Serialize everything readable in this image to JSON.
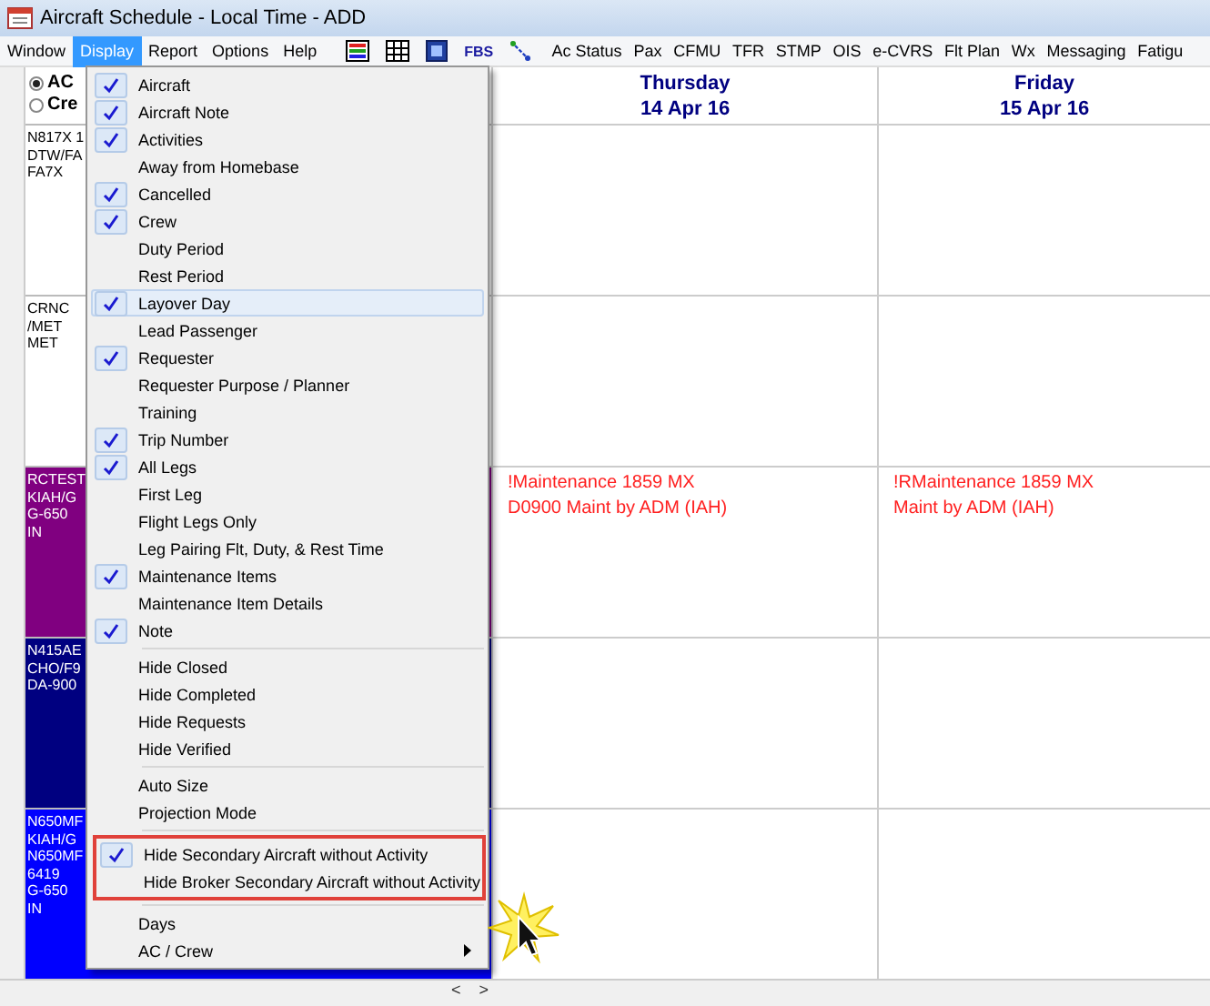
{
  "window": {
    "title": "Aircraft Schedule - Local Time - ADD"
  },
  "menu_bar": {
    "items": [
      {
        "label": "Window",
        "selected": false
      },
      {
        "label": "Display",
        "selected": true
      },
      {
        "label": "Report",
        "selected": false
      },
      {
        "label": "Options",
        "selected": false
      },
      {
        "label": "Help",
        "selected": false
      }
    ],
    "toolbar_text_icon": "FBS",
    "links": [
      "Ac Status",
      "Pax",
      "CFMU",
      "TFR",
      "STMP",
      "OIS",
      "e-CVRS",
      "Flt Plan",
      "Wx",
      "Messaging",
      "Fatigu"
    ]
  },
  "view_mode": [
    {
      "label": "AC",
      "selected": true
    },
    {
      "label": "Cre",
      "selected": false
    }
  ],
  "day_columns": [
    {
      "day": "Thursday",
      "date": "14 Apr 16"
    },
    {
      "day": "Friday",
      "date": "15 Apr 16"
    }
  ],
  "rows": [
    {
      "label": [
        "N817X 1",
        "DTW/FA",
        "FA7X"
      ],
      "color": "#ffffff"
    },
    {
      "label": [
        "CRNC",
        "/MET",
        "MET"
      ],
      "color": "#ffffff"
    },
    {
      "label": [
        "RCTEST",
        "KIAH/G",
        "G-650",
        "IN"
      ],
      "color": "#800080",
      "events": [
        [
          "!Maintenance 1859 MX",
          "D0900 Maint by ADM (IAH)"
        ],
        [
          "!RMaintenance 1859 MX",
          "Maint by ADM (IAH)"
        ]
      ]
    },
    {
      "label": [
        "N415AE",
        "CHO/F9",
        "DA-900"
      ],
      "color": "#000080"
    },
    {
      "label": [
        "N650MF",
        "KIAH/G",
        "N650MF",
        "6419",
        "G-650",
        "IN"
      ],
      "color": "#0000ff"
    }
  ],
  "display_menu": {
    "groups": [
      {
        "highlight_box": false,
        "items": [
          {
            "label": "Aircraft",
            "checked": true,
            "hovered": false,
            "submenu": false
          },
          {
            "label": "Aircraft Note",
            "checked": true,
            "hovered": false,
            "submenu": false
          },
          {
            "label": "Activities",
            "checked": true,
            "hovered": false,
            "submenu": false
          },
          {
            "label": "Away from Homebase",
            "checked": false,
            "hovered": false,
            "submenu": false
          },
          {
            "label": "Cancelled",
            "checked": true,
            "hovered": false,
            "submenu": false
          },
          {
            "label": "Crew",
            "checked": true,
            "hovered": false,
            "submenu": false
          },
          {
            "label": "Duty Period",
            "checked": false,
            "hovered": false,
            "submenu": false
          },
          {
            "label": "Rest Period",
            "checked": false,
            "hovered": false,
            "submenu": false
          },
          {
            "label": "Layover Day",
            "checked": true,
            "hovered": true,
            "submenu": false
          },
          {
            "label": "Lead Passenger",
            "checked": false,
            "hovered": false,
            "submenu": false
          },
          {
            "label": "Requester",
            "checked": true,
            "hovered": false,
            "submenu": false
          },
          {
            "label": "Requester Purpose / Planner",
            "checked": false,
            "hovered": false,
            "submenu": false
          },
          {
            "label": "Training",
            "checked": false,
            "hovered": false,
            "submenu": false
          },
          {
            "label": "Trip Number",
            "checked": true,
            "hovered": false,
            "submenu": false
          },
          {
            "label": "All Legs",
            "checked": true,
            "hovered": false,
            "submenu": false
          },
          {
            "label": "First Leg",
            "checked": false,
            "hovered": false,
            "submenu": false
          },
          {
            "label": "Flight Legs Only",
            "checked": false,
            "hovered": false,
            "submenu": false
          },
          {
            "label": "Leg Pairing Flt, Duty, & Rest Time",
            "checked": false,
            "hovered": false,
            "submenu": false
          },
          {
            "label": "Maintenance Items",
            "checked": true,
            "hovered": false,
            "submenu": false
          },
          {
            "label": "Maintenance Item Details",
            "checked": false,
            "hovered": false,
            "submenu": false
          },
          {
            "label": "Note",
            "checked": true,
            "hovered": false,
            "submenu": false
          }
        ]
      },
      {
        "highlight_box": false,
        "items": [
          {
            "label": "Hide Closed",
            "checked": false,
            "hovered": false,
            "submenu": false
          },
          {
            "label": "Hide Completed",
            "checked": false,
            "hovered": false,
            "submenu": false
          },
          {
            "label": "Hide Requests",
            "checked": false,
            "hovered": false,
            "submenu": false
          },
          {
            "label": "Hide Verified",
            "checked": false,
            "hovered": false,
            "submenu": false
          }
        ]
      },
      {
        "highlight_box": false,
        "items": [
          {
            "label": "Auto Size",
            "checked": false,
            "hovered": false,
            "submenu": false
          },
          {
            "label": "Projection Mode",
            "checked": false,
            "hovered": false,
            "submenu": false
          }
        ]
      },
      {
        "highlight_box": true,
        "items": [
          {
            "label": "Hide Secondary Aircraft without Activity",
            "checked": true,
            "hovered": false,
            "submenu": false
          },
          {
            "label": "Hide Broker Secondary Aircraft without Activity",
            "checked": false,
            "hovered": false,
            "submenu": false
          }
        ]
      },
      {
        "highlight_box": false,
        "items": [
          {
            "label": "Days",
            "checked": false,
            "hovered": false,
            "submenu": false
          },
          {
            "label": "AC / Crew",
            "checked": false,
            "hovered": false,
            "submenu": true
          }
        ]
      }
    ]
  },
  "pager": [
    "<",
    ">"
  ]
}
